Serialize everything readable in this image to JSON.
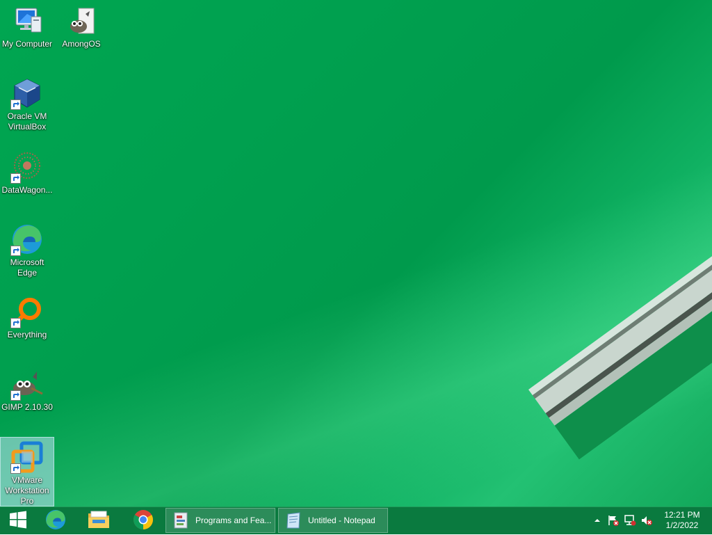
{
  "desktop": {
    "icons": [
      {
        "label": "My Computer"
      },
      {
        "label": "AmongOS"
      },
      {
        "label": "Oracle VM VirtualBox"
      },
      {
        "label": "DataWagon..."
      },
      {
        "label": "Microsoft Edge"
      },
      {
        "label": "Everything"
      },
      {
        "label": "GIMP 2.10.30"
      },
      {
        "label": "VMware Workstation Pro"
      }
    ]
  },
  "taskbar": {
    "pinned": [
      {
        "icon": "windows-start-icon"
      },
      {
        "icon": "edge-icon"
      },
      {
        "icon": "file-explorer-icon"
      },
      {
        "icon": "chrome-icon"
      }
    ],
    "tasks": [
      {
        "label": "Programs and Fea...",
        "icon": "programs-features-icon"
      },
      {
        "label": "Untitled - Notepad",
        "icon": "notepad-icon"
      }
    ],
    "tray": {
      "time": "12:21 PM",
      "date": "1/2/2022"
    }
  },
  "colors": {
    "wallpaper": "#00a651",
    "taskbar": "#0a7a3f"
  }
}
